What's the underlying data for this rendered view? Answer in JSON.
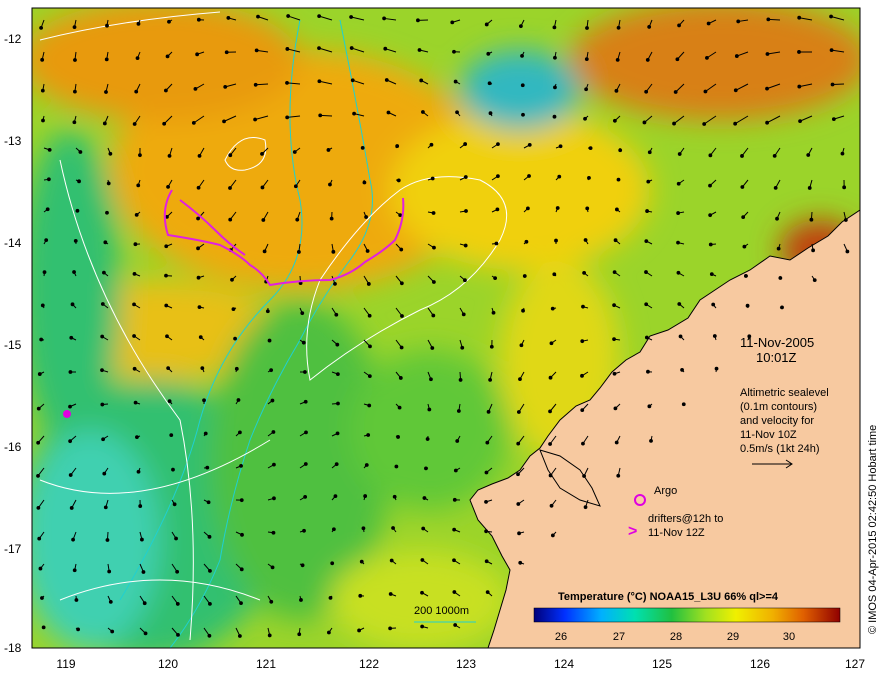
{
  "map": {
    "lat_ticks": [
      "-12",
      "-13",
      "-14",
      "-15",
      "-16",
      "-17",
      "-18"
    ],
    "lon_ticks": [
      "119",
      "120",
      "121",
      "122",
      "123",
      "124",
      "125",
      "126",
      "127"
    ],
    "date": "11-Nov-2005",
    "time": "10:01Z",
    "altimetry_lines": [
      "Altimetric sealevel",
      "(0.1m contours)",
      "and velocity for",
      "11-Nov 10Z",
      "0.5m/s (1kt 24h)"
    ],
    "argo_label": "Argo",
    "drifters_lines": [
      "drifters@12h to",
      "11-Nov 12Z"
    ],
    "depth_legend": "200  1000m",
    "colorbar_title": "Temperature (°C) NOAA15_L3U 66% ql>=4",
    "colorbar_ticks": [
      "26",
      "27",
      "28",
      "29",
      "30"
    ],
    "credit": "© IMOS 04-Apr-2015 02:42:50 Hobart time",
    "colors": {
      "land": "#f7c9a0",
      "argo": "#e000e0",
      "drifter": "#e020e0",
      "contour_200": "#20d0d0",
      "sealevel_contour": "#ffffff"
    }
  }
}
